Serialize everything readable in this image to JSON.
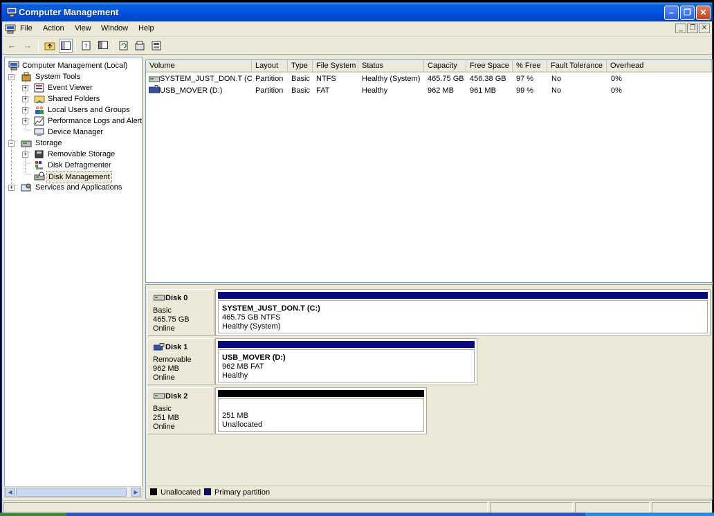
{
  "window": {
    "title": "Computer Management"
  },
  "menu": [
    "File",
    "Action",
    "View",
    "Window",
    "Help"
  ],
  "toolbar": {
    "icons": [
      "back-arrow-icon",
      "forward-arrow-icon",
      "up-folder-icon",
      "show-hide-tree-icon",
      "properties-icon",
      "export-list-icon",
      "refresh-icon",
      "help-icon",
      "console-icon"
    ]
  },
  "tree": {
    "root": "Computer Management (Local)",
    "items": [
      {
        "label": "System Tools",
        "icon": "toolbox-icon"
      },
      {
        "label": "Event Viewer",
        "icon": "event-viewer-icon"
      },
      {
        "label": "Shared Folders",
        "icon": "shared-folder-icon"
      },
      {
        "label": "Local Users and Groups",
        "icon": "users-icon"
      },
      {
        "label": "Performance Logs and Alerts",
        "icon": "performance-icon"
      },
      {
        "label": "Device Manager",
        "icon": "device-manager-icon"
      },
      {
        "label": "Storage",
        "icon": "storage-icon"
      },
      {
        "label": "Removable Storage",
        "icon": "removable-storage-icon"
      },
      {
        "label": "Disk Defragmenter",
        "icon": "defrag-icon"
      },
      {
        "label": "Disk Management",
        "icon": "disk-management-icon"
      },
      {
        "label": "Services and Applications",
        "icon": "services-icon"
      }
    ]
  },
  "volumes": {
    "columns": [
      "Volume",
      "Layout",
      "Type",
      "File System",
      "Status",
      "Capacity",
      "Free Space",
      "% Free",
      "Fault Tolerance",
      "Overhead"
    ],
    "rows": [
      [
        "SYSTEM_JUST_DON.T (C:)",
        "Partition",
        "Basic",
        "NTFS",
        "Healthy (System)",
        "465.75 GB",
        "456.38 GB",
        "97 %",
        "No",
        "0%"
      ],
      [
        "USB_MOVER (D:)",
        "Partition",
        "Basic",
        "FAT",
        "Healthy",
        "962 MB",
        "961 MB",
        "99 %",
        "No",
        "0%"
      ]
    ]
  },
  "disks": [
    {
      "name": "Disk 0",
      "type": "Basic",
      "size": "465.75 GB",
      "state": "Online",
      "partition": {
        "title": "SYSTEM_JUST_DON.T  (C:)",
        "detail": "465.75 GB NTFS",
        "status": "Healthy (System)"
      },
      "stripe_color": "#0a0a80"
    },
    {
      "name": "Disk 1",
      "type": "Removable",
      "size": "962 MB",
      "state": "Online",
      "partition": {
        "title": "USB_MOVER  (D:)",
        "detail": "962 MB FAT",
        "status": "Healthy"
      },
      "stripe_color": "#0a0a80"
    },
    {
      "name": "Disk 2",
      "type": "Basic",
      "size": "251 MB",
      "state": "Online",
      "partition": {
        "title": "",
        "detail": "251 MB",
        "status": "Unallocated"
      },
      "stripe_color": "#000000"
    }
  ],
  "legend": [
    {
      "label": "Unallocated",
      "color": "#000000"
    },
    {
      "label": "Primary partition",
      "color": "#0a0a80"
    }
  ]
}
